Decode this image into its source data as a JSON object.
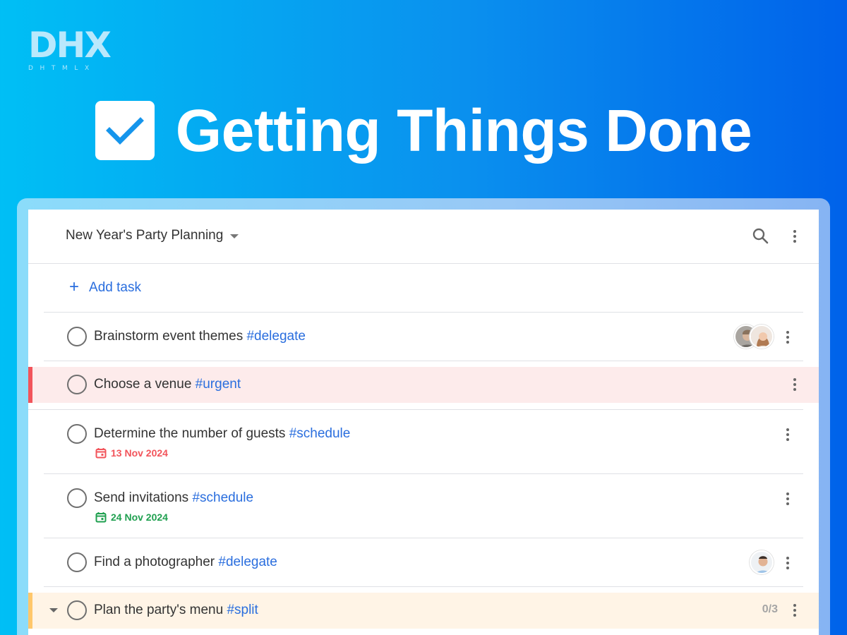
{
  "logo": {
    "mark": "DHX",
    "sub": "DHTMLX"
  },
  "headline": {
    "title": "Getting Things Done",
    "icon": "checkbox-checked-icon"
  },
  "header": {
    "project_name": "New Year's Party Planning",
    "icons": [
      "search-icon",
      "more-vert-icon"
    ]
  },
  "add_task": {
    "label": "Add task",
    "icon": "plus-icon"
  },
  "tasks": [
    {
      "text": "Brainstorm event themes",
      "tag": "#delegate",
      "assignees": [
        "avatar-man",
        "avatar-woman"
      ]
    },
    {
      "text": "Choose a venue",
      "tag": "#urgent",
      "priority_color": "#f2545b"
    },
    {
      "text": "Determine the number of guests",
      "tag": "#schedule",
      "due": "13 Nov 2024",
      "due_color": "#f2545b"
    },
    {
      "text": "Send invitations",
      "tag": "#schedule",
      "due": "24 Nov 2024",
      "due_color": "#20a050"
    },
    {
      "text": "Find a photographer",
      "tag": "#delegate",
      "assignees": [
        "avatar-man-2"
      ]
    },
    {
      "text": "Plan the party's menu",
      "tag": "#split",
      "subtasks_count": "0/3",
      "priority_color": "#ffc76b"
    }
  ],
  "colors": {
    "accent": "#2a6ede",
    "gradient_start": "#00bff5",
    "gradient_end": "#0062ea"
  }
}
